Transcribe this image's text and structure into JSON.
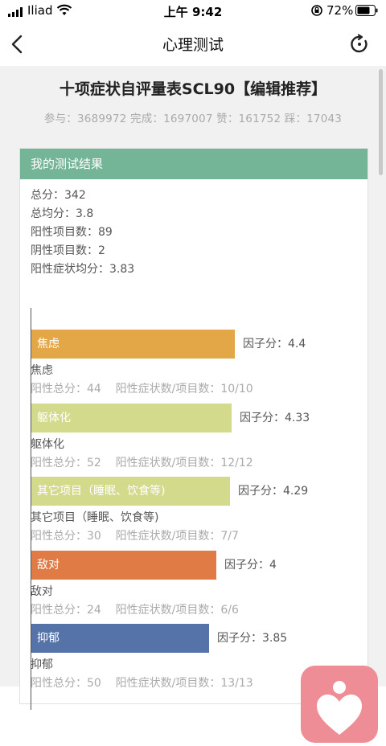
{
  "status": {
    "carrier": "Iliad",
    "time": "上午 9:42",
    "battery": "72%"
  },
  "nav": {
    "title": "心理测试"
  },
  "test": {
    "title": "十项症状自评量表SCL90【编辑推荐】",
    "stats": "参与：3689972 完成：1697007 赞：161752 踩：17043"
  },
  "result": {
    "header": "我的测试结果",
    "summary": [
      "总分：342",
      "总均分：3.8",
      "阳性项目数：89",
      "阴性项目数：2",
      "阳性症状均分：3.83"
    ]
  },
  "chart_data": {
    "type": "bar",
    "orientation": "horizontal",
    "categories": [
      "焦虑",
      "躯体化",
      "其它项目（睡眠、饮食等)",
      "敌对",
      "抑郁"
    ],
    "values": [
      4.4,
      4.33,
      4.29,
      4,
      3.85
    ],
    "value_labels": [
      "因子分：4.4",
      "因子分：4.33",
      "因子分：4.29",
      "因子分：4",
      "因子分：3.85"
    ],
    "colors": [
      "#e4a747",
      "#d4da8b",
      "#d4da8b",
      "#e07b46",
      "#5673a9"
    ],
    "details": [
      "阳性总分：44    阳性症状数/项目数：10/10",
      "阳性总分：52    阳性症状数/项目数：12/12",
      "阳性总分：30    阳性症状数/项目数：7/7",
      "阳性总分：24    阳性症状数/项目数：6/6",
      "阳性总分：50    阳性症状数/项目数：13/13"
    ],
    "names": [
      "焦虑",
      "躯体化",
      "其它项目（睡眠、饮食等)",
      "敌对",
      "抑郁"
    ]
  }
}
